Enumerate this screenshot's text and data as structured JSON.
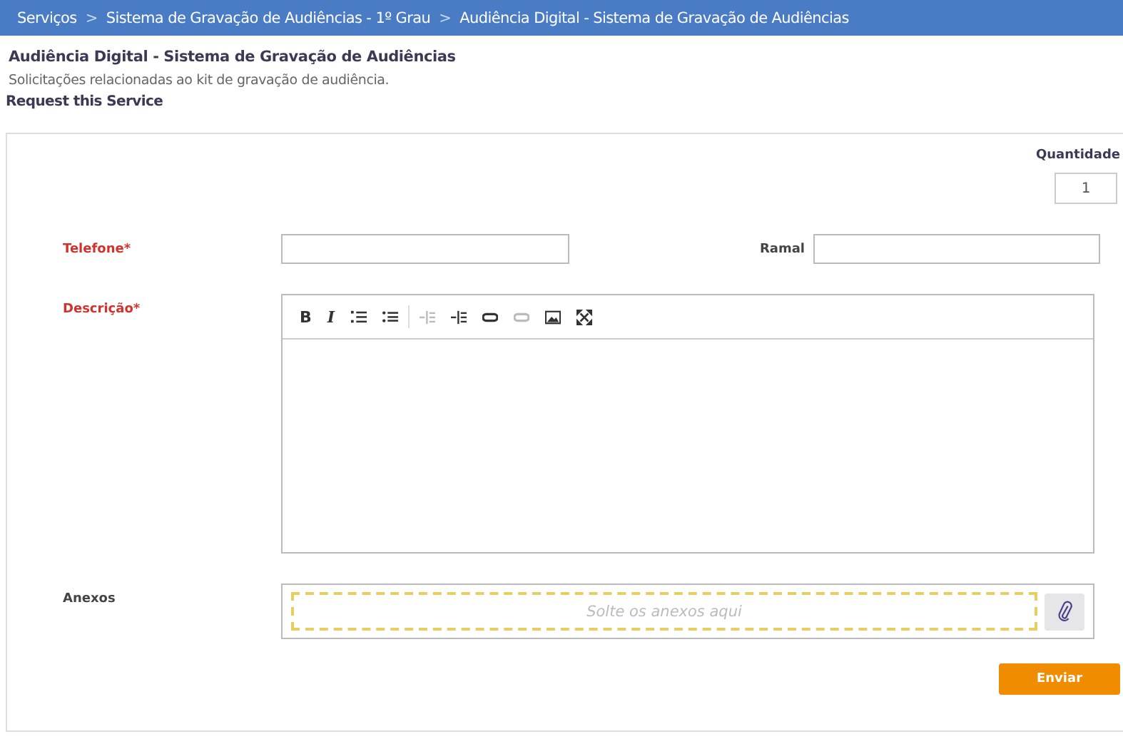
{
  "breadcrumb": [
    {
      "label": "Serviços"
    },
    {
      "label": "Sistema de Gravação de Audiências - 1º Grau"
    },
    {
      "label": "Audiência Digital - Sistema de Gravação de Audiências"
    }
  ],
  "breadcrumb_separator": ">",
  "required_mark": "*",
  "title": "Audiência Digital - Sistema de Gravação de Audiências",
  "description": "Solicitações relacionadas ao kit de gravação de audiência.",
  "request_link": "Request this Service",
  "quantity": {
    "label": "Quantidade",
    "value": "1"
  },
  "phone": {
    "label": "Telefone",
    "required": true
  },
  "extension": {
    "label": "Ramal",
    "required": false
  },
  "description_field": {
    "label": "Descrição",
    "required": true
  },
  "toolbar": [
    {
      "kind": "bold",
      "label": "B",
      "disabled": false
    },
    {
      "kind": "italic",
      "label": "I",
      "disabled": false
    },
    {
      "kind": "ordered-list",
      "disabled": false
    },
    {
      "kind": "bullet-list",
      "disabled": false
    },
    {
      "kind": "separator"
    },
    {
      "kind": "outdent",
      "disabled": true
    },
    {
      "kind": "indent",
      "disabled": false
    },
    {
      "kind": "link",
      "disabled": false
    },
    {
      "kind": "unlink",
      "disabled": true
    },
    {
      "kind": "image",
      "disabled": false
    },
    {
      "kind": "fullscreen",
      "disabled": false
    }
  ],
  "attachments": {
    "label": "Anexos",
    "placeholder": "Solte os anexos aqui"
  },
  "submit": "Enviar"
}
